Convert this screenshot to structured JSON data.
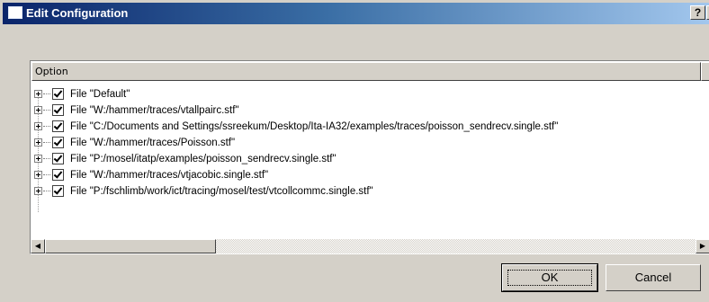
{
  "window": {
    "title": "Edit Configuration",
    "help_label": "?",
    "close_label": "X"
  },
  "list": {
    "column_header": "Option",
    "items": [
      {
        "label": "File \"Default\"",
        "checked": true
      },
      {
        "label": "File \"W:/hammer/traces/vtallpairc.stf\"",
        "checked": true
      },
      {
        "label": "File \"C:/Documents and Settings/ssreekum/Desktop/Ita-IA32/examples/traces/poisson_sendrecv.single.stf\"",
        "checked": true
      },
      {
        "label": "File \"W:/hammer/traces/Poisson.stf\"",
        "checked": true
      },
      {
        "label": "File \"P:/mosel/itatp/examples/poisson_sendrecv.single.stf\"",
        "checked": true
      },
      {
        "label": "File \"W:/hammer/traces/vtjacobic.single.stf\"",
        "checked": true
      },
      {
        "label": "File \"P:/fschlimb/work/ict/tracing/mosel/test/vtcollcommc.single.stf\"",
        "checked": true
      }
    ]
  },
  "scrollbar": {
    "left_arrow": "◀",
    "right_arrow": "▶"
  },
  "buttons": {
    "ok_label": "OK",
    "cancel_label": "Cancel"
  }
}
